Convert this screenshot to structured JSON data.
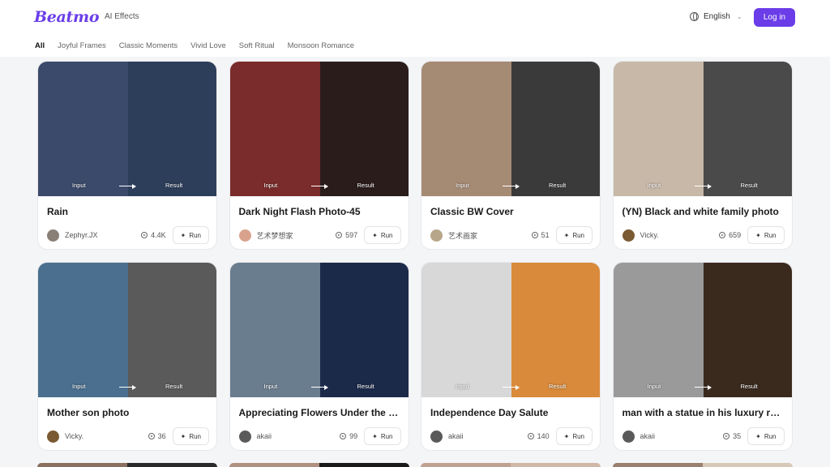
{
  "header": {
    "logo": "Beatmo",
    "nav_link": "AI Effects",
    "language": "English",
    "login_label": "Log in"
  },
  "tabs": [
    {
      "label": "All",
      "active": true
    },
    {
      "label": "Joyful Frames"
    },
    {
      "label": "Classic Moments"
    },
    {
      "label": "Vivid Love"
    },
    {
      "label": "Soft Ritual"
    },
    {
      "label": "Monsoon Romance"
    }
  ],
  "card_labels": {
    "input": "Input",
    "result": "Result",
    "run": "Run"
  },
  "cards": [
    {
      "title": "Rain",
      "author": "Zephyr.JX",
      "views": "4.4K",
      "input_color": "#3b4a6b",
      "result_color": "#2c3e5a",
      "avatar_color": "#8a7f77"
    },
    {
      "title": "Dark Night Flash Photo-45",
      "author": "艺术梦想家",
      "views": "597",
      "input_color": "#7a2b2b",
      "result_color": "#2b1c1c",
      "avatar_color": "#d9a28c"
    },
    {
      "title": "Classic BW Cover",
      "author": "艺术画家",
      "views": "51",
      "input_color": "#a58a74",
      "result_color": "#3a3a3a",
      "avatar_color": "#b8a68a"
    },
    {
      "title": "(YN) Black and white family photo",
      "author": "Vicky.",
      "views": "659",
      "input_color": "#c7b8a8",
      "result_color": "#4a4a4a",
      "avatar_color": "#7a5a32"
    },
    {
      "title": "Mother son photo",
      "author": "Vicky.",
      "views": "36",
      "input_color": "#4a6f8f",
      "result_color": "#5a5a5a",
      "avatar_color": "#7a5a32"
    },
    {
      "title": "Appreciating Flowers Under the Moon",
      "author": "akaii",
      "views": "99",
      "input_color": "#6a7d8f",
      "result_color": "#1c2a4a",
      "avatar_color": "#5a5a5a"
    },
    {
      "title": "Independence Day Salute",
      "author": "akaii",
      "views": "140",
      "input_color": "#d8d8d8",
      "result_color": "#d98a3a",
      "avatar_color": "#5a5a5a"
    },
    {
      "title": "man with a statue in his luxury room",
      "author": "akaii",
      "views": "35",
      "input_color": "#9a9a9a",
      "result_color": "#3a2a1e",
      "avatar_color": "#5a5a5a"
    }
  ],
  "row3_colors": [
    [
      "#8a7060",
      "#2a2a2a"
    ],
    [
      "#b09080",
      "#1a1a1a"
    ],
    [
      "#c0a090",
      "#d0b8a8"
    ],
    [
      "#9a8070",
      "#d8c8b8"
    ]
  ]
}
